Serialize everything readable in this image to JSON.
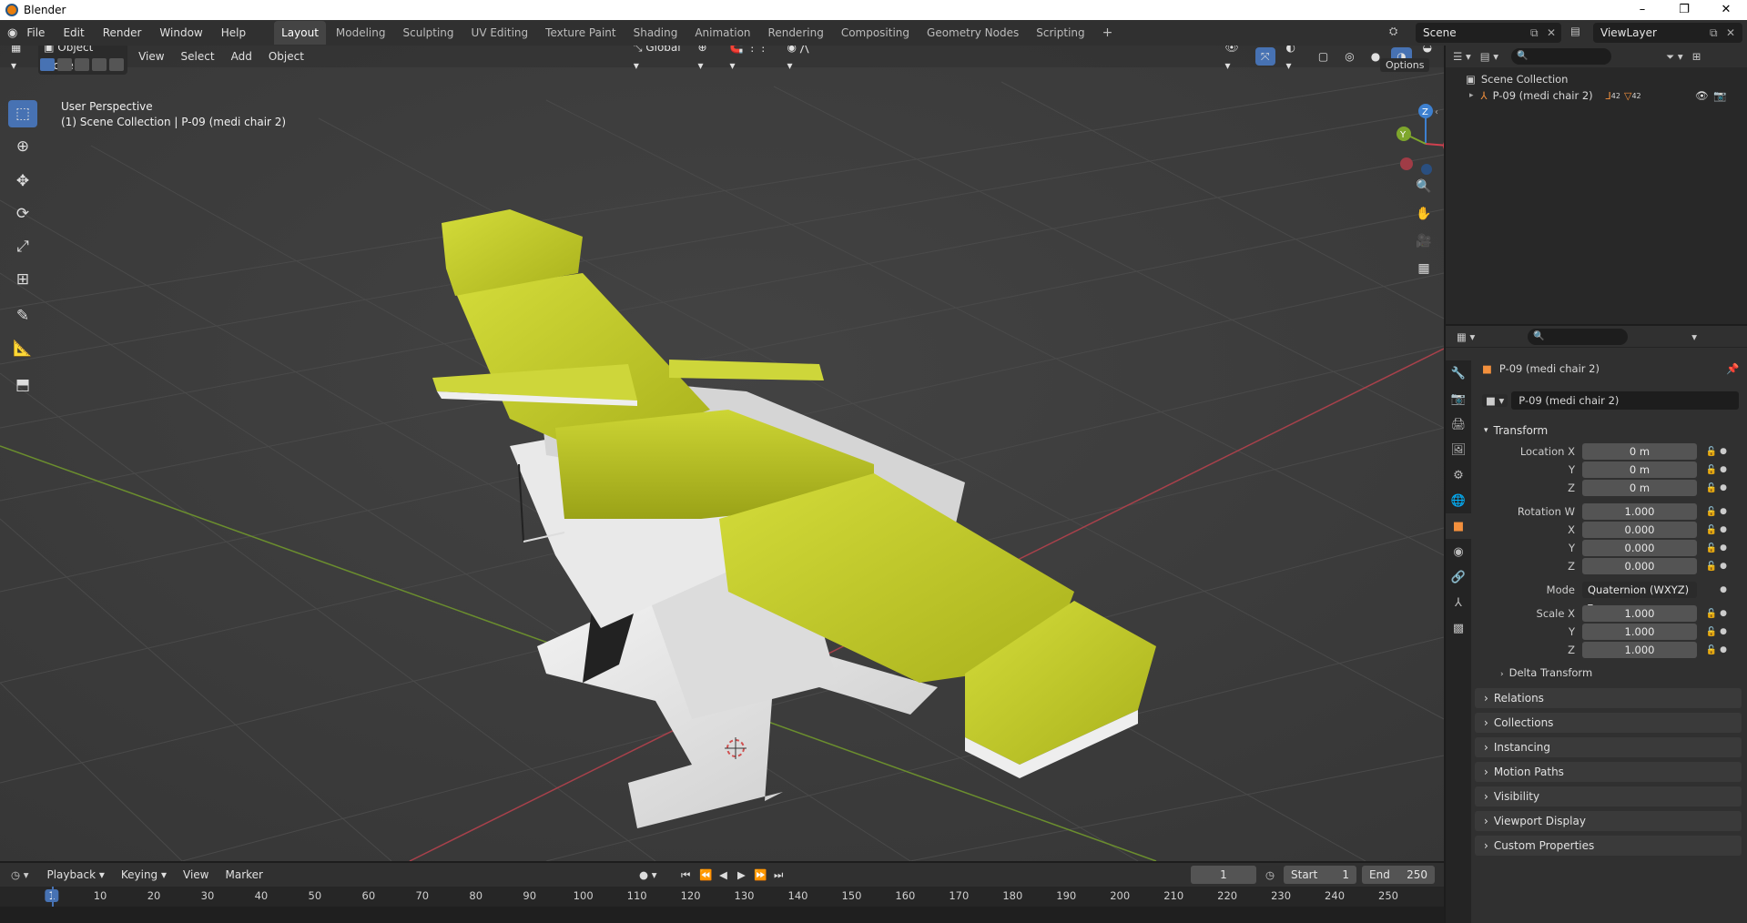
{
  "window": {
    "title": "Blender",
    "controls": [
      "–",
      "❐",
      "✕"
    ]
  },
  "menu": [
    "File",
    "Edit",
    "Render",
    "Window",
    "Help"
  ],
  "workspaces": [
    {
      "label": "Layout",
      "active": true
    },
    {
      "label": "Modeling"
    },
    {
      "label": "Sculpting"
    },
    {
      "label": "UV Editing"
    },
    {
      "label": "Texture Paint"
    },
    {
      "label": "Shading"
    },
    {
      "label": "Animation"
    },
    {
      "label": "Rendering"
    },
    {
      "label": "Compositing"
    },
    {
      "label": "Geometry Nodes"
    },
    {
      "label": "Scripting"
    }
  ],
  "add_workspace": "+",
  "scene": {
    "name": "Scene",
    "view_layer": "ViewLayer"
  },
  "viewport": {
    "mode": "Object Mode",
    "menus": [
      "View",
      "Select",
      "Add",
      "Object"
    ],
    "orientation": "Global",
    "options": "Options",
    "perspective": "User Perspective",
    "collection_info": "(1) Scene Collection | P-09 (medi chair 2)",
    "gizmo_axes": {
      "z": "Z",
      "y": "Y",
      "x": "X"
    }
  },
  "tools": [
    "select-box",
    "cursor",
    "move",
    "rotate",
    "scale",
    "transform",
    "annotate",
    "measure",
    "add-cube"
  ],
  "outliner": {
    "root": "Scene Collection",
    "items": [
      {
        "name": "P-09 (medi chair 2)",
        "counts": [
          "42",
          "42"
        ]
      }
    ]
  },
  "properties": {
    "object_name": "P-09 (medi chair 2)",
    "data_name": "P-09 (medi chair 2)",
    "transform": {
      "title": "Transform",
      "location_label": "Location X",
      "y_label": "Y",
      "z_label": "Z",
      "location": [
        "0 m",
        "0 m",
        "0 m"
      ],
      "rotation_label": "Rotation W",
      "x_label": "X",
      "rotation": [
        "1.000",
        "0.000",
        "0.000",
        "0.000"
      ],
      "mode_label": "Mode",
      "mode": "Quaternion (WXYZ)",
      "scale_label": "Scale X",
      "scale": [
        "1.000",
        "1.000",
        "1.000"
      ]
    },
    "delta_transform": "Delta Transform",
    "panels": [
      "Relations",
      "Collections",
      "Instancing",
      "Motion Paths",
      "Visibility",
      "Viewport Display",
      "Custom Properties"
    ]
  },
  "timeline": {
    "menus": [
      "Playback",
      "Keying",
      "View",
      "Marker"
    ],
    "current_frame": "1",
    "start_label": "Start",
    "start": "1",
    "end_label": "End",
    "end": "250",
    "ticks": [
      "1",
      "10",
      "20",
      "30",
      "40",
      "50",
      "60",
      "70",
      "80",
      "90",
      "100",
      "110",
      "120",
      "130",
      "140",
      "150",
      "160",
      "170",
      "180",
      "190",
      "200",
      "210",
      "220",
      "230",
      "240",
      "250"
    ]
  },
  "colors": {
    "accent": "#4772b3",
    "object_orange": "#f3903d",
    "chair_cushion": "#c8d02c",
    "axis_x": "#d0404f",
    "axis_y": "#7ea62c",
    "axis_z": "#3d80d0"
  }
}
